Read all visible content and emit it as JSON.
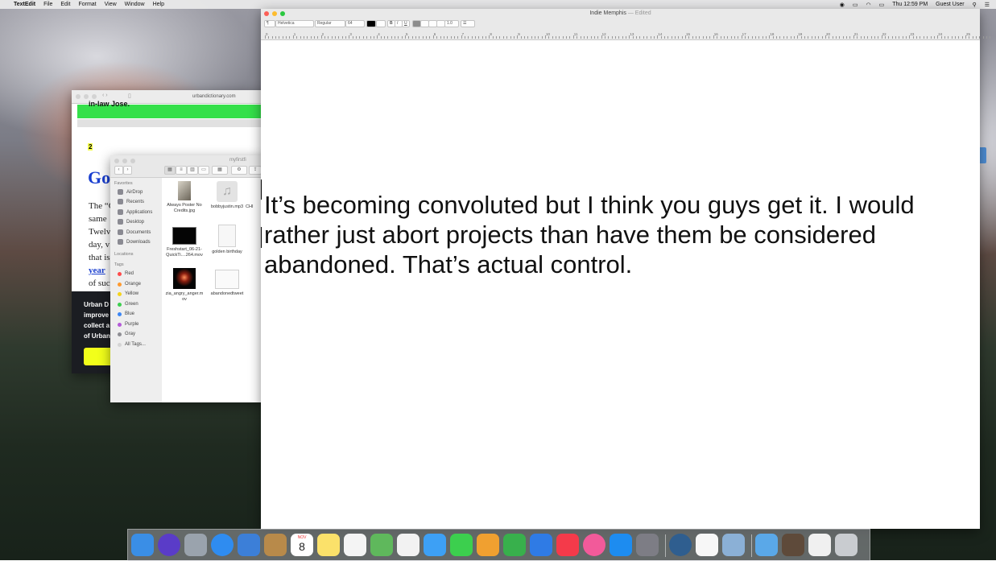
{
  "menubar": {
    "apple": "",
    "app": "TextEdit",
    "items": [
      "File",
      "Edit",
      "Format",
      "View",
      "Window",
      "Help"
    ],
    "clock": "Thu 12:59 PM",
    "user": "Guest User"
  },
  "browser": {
    "url": "urbandictionary.com",
    "top_text": "in-law Jose.",
    "number": "2",
    "title": "Go",
    "body_lines": [
      "The “C",
      "same",
      "Twelv",
      "day, v",
      "that is"
    ],
    "link": "year",
    "last_line": "of suc",
    "banner_lines": [
      "Urban D",
      "improve",
      "collect a",
      "of Urban"
    ]
  },
  "finder": {
    "title": "myfirstfi",
    "favorites_header": "Favorites",
    "favorites": [
      "AirDrop",
      "Recents",
      "Applications",
      "Desktop",
      "Documents",
      "Downloads"
    ],
    "locations_header": "Locations",
    "tags_header": "Tags",
    "tags": [
      {
        "label": "Red",
        "color": "#ff4b4b"
      },
      {
        "label": "Orange",
        "color": "#ff9a2e"
      },
      {
        "label": "Yellow",
        "color": "#f5d31b"
      },
      {
        "label": "Green",
        "color": "#3ccf4e"
      },
      {
        "label": "Blue",
        "color": "#3b86f5"
      },
      {
        "label": "Purple",
        "color": "#b45ad8"
      },
      {
        "label": "Gray",
        "color": "#8e8e93"
      },
      {
        "label": "All Tags...",
        "color": "#d4d4d4"
      }
    ],
    "files": [
      {
        "line1": "Always Poster No",
        "line2": "Credits.jpg"
      },
      {
        "line1": "bobbyjustin.mp3",
        "line2": ""
      },
      {
        "line1": "CHI",
        "line2": ""
      },
      {
        "line1": "Freshstart_06-21-",
        "line2": "QuickTi....264.mov"
      },
      {
        "line1": "golden birthday",
        "line2": ""
      },
      {
        "line1": "zia_angry_anger.m",
        "line2": "ov"
      },
      {
        "line1": "abandonedtweet",
        "line2": ""
      }
    ]
  },
  "textedit": {
    "title": "Indie Memphis",
    "edited": "— Edited",
    "toolbar": {
      "paragraph": "¶",
      "font": "Helvetica",
      "style": "Regular",
      "size": "64",
      "spacing": "1.0",
      "list": "☰"
    },
    "ruler_numbers": [
      "0",
      "1",
      "2",
      "3",
      "4",
      "5",
      "6",
      "7",
      "8",
      "9",
      "10",
      "11",
      "12",
      "13",
      "14",
      "15",
      "16",
      "17",
      "18",
      "19",
      "20",
      "21",
      "22",
      "23",
      "24",
      "25"
    ],
    "document_lines": [
      "It’s becoming convoluted but I think you guys get it. I would",
      "rather just abort projects than have them be considered",
      "abandoned. That’s actual control."
    ]
  },
  "dock": {
    "apps": [
      "finder-icon",
      "siri-icon",
      "launchpad-icon",
      "safari-icon",
      "mail-icon",
      "contacts-icon",
      "calendar-icon",
      "notes-icon",
      "reminders-icon",
      "maps-icon",
      "photos-icon",
      "messages-icon",
      "facetime-icon",
      "pages-icon",
      "numbers-icon",
      "keynote-icon",
      "news-icon",
      "itunes-icon",
      "app-store-icon",
      "system-preferences-icon",
      "quicktime-icon",
      "textedit-icon",
      "preview-icon",
      "downloads-folder-icon",
      "desktop-stack-icon",
      "document-stack-icon",
      "trash-icon"
    ],
    "calendar_month": "NOV",
    "calendar_day": "8"
  },
  "colors": {
    "accent_green": "#35e04a",
    "link_blue": "#1a3fd0",
    "banner_cta": "#f2ff1a"
  }
}
